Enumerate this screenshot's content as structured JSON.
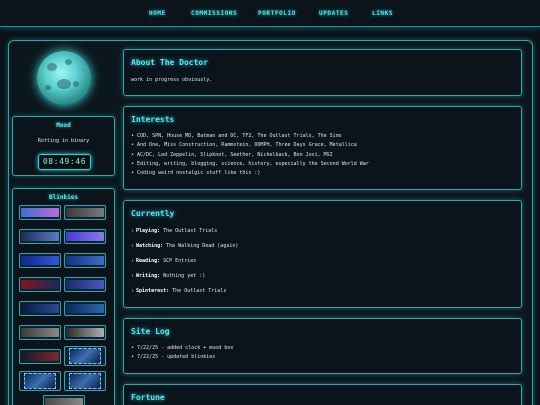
{
  "nav": {
    "home": "HOME",
    "commissions": "COMMISSIONS",
    "portfolio": "PORTFOLIO",
    "updates": "UPDATES",
    "links": "LINKS"
  },
  "sidebar": {
    "mood": {
      "title": "Mood",
      "text": "Rotting in binary",
      "clock": "08:49:46"
    },
    "blinkies": {
      "title": "Blinkies"
    }
  },
  "about": {
    "title": "About The Doctor",
    "text": "work in progress obviously."
  },
  "interests": {
    "title": "Interests",
    "items": [
      "COD, SPN, House MD, Batman and DC, TF2, The Outlast Trials, The Sims",
      "And One, Miss Construction, Rammstein, OOMPH, Three Days Grace, Metallica",
      "AC/DC, Led Zeppelin, Slipknot, Seether, Nickelback, Bon Jovi, MSI",
      "Editing, writing, blogging, science, history, especially the Second World War",
      "Coding weird nostalgic stuff like this :)"
    ]
  },
  "currently": {
    "title": "Currently",
    "rows": [
      {
        "label": "Playing:",
        "value": "The Outlast Trials"
      },
      {
        "label": "Watching:",
        "value": "The Walking Dead (again)"
      },
      {
        "label": "Reading:",
        "value": "SCP Entries"
      },
      {
        "label": "Writing:",
        "value": "Nothing yet :)"
      },
      {
        "label": "Spinterest:",
        "value": "The Outlast Trials"
      }
    ]
  },
  "sitelog": {
    "title": "Site Log",
    "items": [
      "7/22/25 - added clock + mood box",
      "7/22/25 - updated blinkies"
    ]
  },
  "fortune": {
    "title": "Fortune"
  },
  "colors": {
    "accent": "#2ad4dc",
    "background": "#0a1218",
    "panel": "#0a141a"
  },
  "icons": {
    "moon": "moon-icon",
    "arrow": "up-arrow-icon"
  }
}
